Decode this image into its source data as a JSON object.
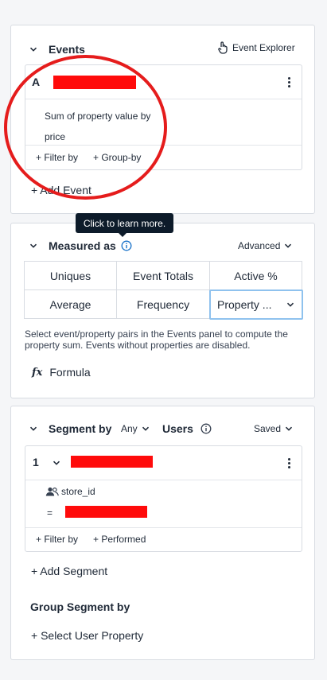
{
  "events": {
    "title": "Events",
    "explorer_label": "Event Explorer",
    "card": {
      "letter": "A",
      "description_line1": "Sum of property value by",
      "description_line2": "price",
      "filter_label": "+ Filter by",
      "group_label": "+ Group-by"
    },
    "add_event_label": "+ Add Event"
  },
  "measured": {
    "title": "Measured as",
    "tooltip": "Click to learn more.",
    "advanced_label": "Advanced",
    "options": [
      "Uniques",
      "Event Totals",
      "Active %",
      "Average",
      "Frequency",
      "Property ..."
    ],
    "description": "Select event/property pairs in the Events panel to compute the property sum. Events without properties are disabled.",
    "formula_icon_text": "fx",
    "formula_label": "Formula"
  },
  "segment": {
    "title": "Segment by",
    "any_label": "Any",
    "users_label": "Users",
    "saved_label": "Saved",
    "card": {
      "number": "1",
      "property": "store_id",
      "operator": "=",
      "filter_label": "+ Filter by",
      "performed_label": "+ Performed"
    },
    "add_segment_label": "+ Add Segment",
    "group_title": "Group Segment by",
    "select_property_label": "+ Select User Property"
  },
  "colors": {
    "annotation_red": "#e51c1c",
    "redaction_red": "#ff0b0b",
    "info_blue": "#1a73c9",
    "tooltip_bg": "#0d1b2a",
    "selected_border": "#8fc2ee"
  }
}
